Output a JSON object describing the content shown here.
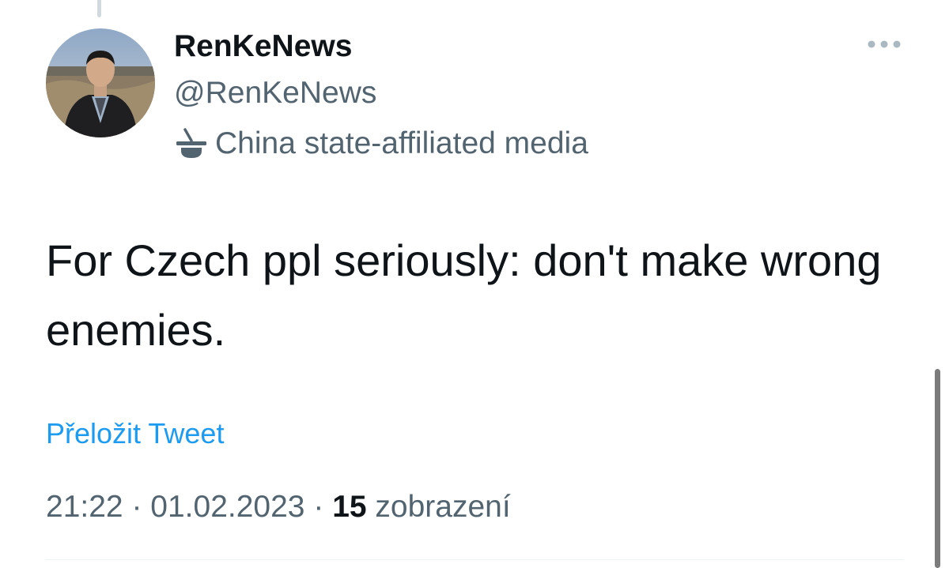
{
  "author": {
    "display_name": "RenKeNews",
    "handle": "@RenKeNews",
    "label": "China state-affiliated media",
    "label_icon": "state-media-icon",
    "avatar_icon": "profile-photo"
  },
  "header": {
    "more_icon": "more-options-icon"
  },
  "tweet": {
    "text": "For Czech ppl seriously: don't make wrong enemies.",
    "translate_label": "Přeložit Tweet"
  },
  "meta": {
    "time": "21:22",
    "separator": "·",
    "date": "01.02.2023",
    "views_count": "15",
    "views_label": "zobrazení"
  },
  "colors": {
    "primary_text": "#0f1419",
    "secondary_text": "#536471",
    "link": "#1d9bf0",
    "divider": "#eff3f4"
  }
}
